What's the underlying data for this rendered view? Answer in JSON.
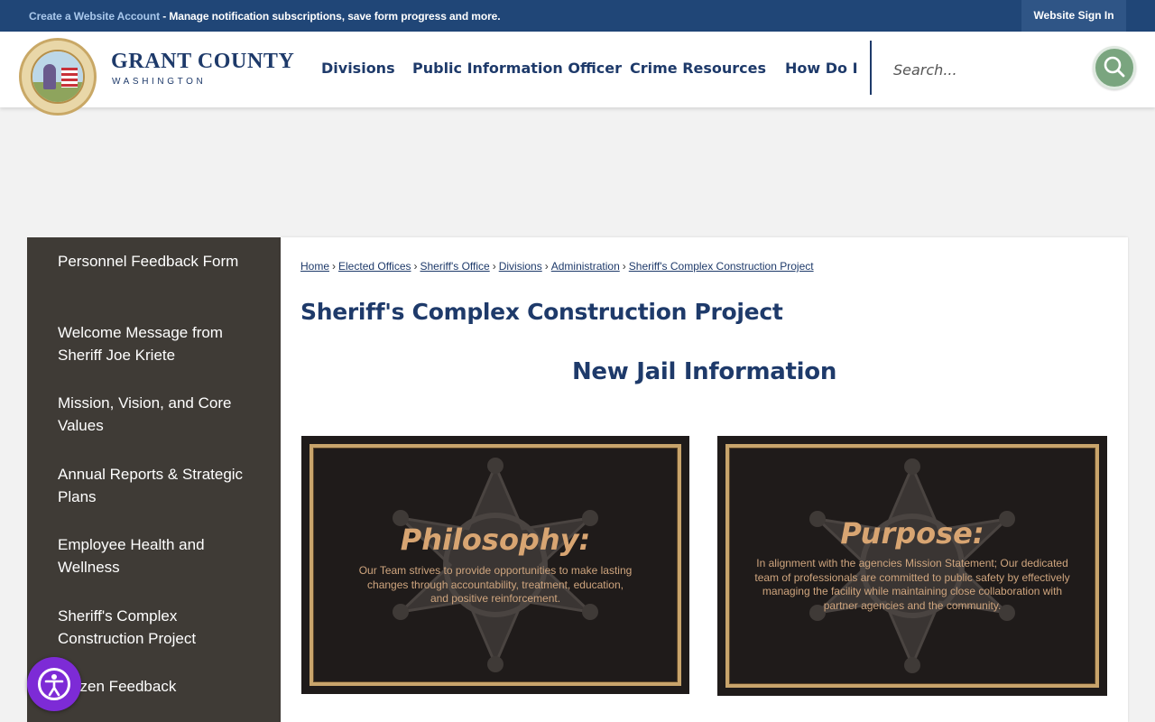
{
  "topbar": {
    "create_account": "Create a Website Account",
    "message": " - Manage notification subscriptions, save form progress and more.",
    "signin": "Website Sign In"
  },
  "header": {
    "logo_title": "GRANT COUNTY",
    "logo_subtitle": "WASHINGTON",
    "nav": [
      "Divisions",
      "Public Information Officer",
      "Crime Resources",
      "How Do I"
    ],
    "search_placeholder": "Search..."
  },
  "sidebar": {
    "items": [
      "Personnel Feedback Form",
      "Welcome Message from Sheriff Joe Kriete",
      "Mission, Vision, and Core Values",
      "Annual Reports & Strategic Plans",
      "Employee Health and Wellness",
      "Sheriff's Complex Construction Project",
      "Citizen Feedback"
    ]
  },
  "main": {
    "breadcrumbs": [
      "Home",
      "Elected Offices",
      "Sheriff's Office",
      "Divisions",
      "Administration",
      "Sheriff's Complex Construction Project"
    ],
    "title": "Sheriff's Complex Construction Project",
    "subtitle": "New Jail Information",
    "plaques": [
      {
        "title": "Philosophy:",
        "text": "Our Team strives to provide opportunities to make lasting changes through accountability, treatment, education, and positive reinforcement."
      },
      {
        "title": "Purpose:",
        "text": "In alignment with the agencies Mission Statement; Our dedicated team of professionals are committed to public safety by effectively managing the facility while maintaining close collaboration with partner agencies and the community."
      }
    ]
  },
  "colors": {
    "topbar": "#204677",
    "navy": "#1e3a6a",
    "sidebar": "#3f3b36",
    "search_button": "#7aa57f",
    "plaque_gold": "#c8a46b",
    "accessibility": "#7d2bd6"
  },
  "icons": {
    "search": "search-icon",
    "accessibility": "accessibility-icon",
    "badge": "sheriff-star-icon"
  }
}
